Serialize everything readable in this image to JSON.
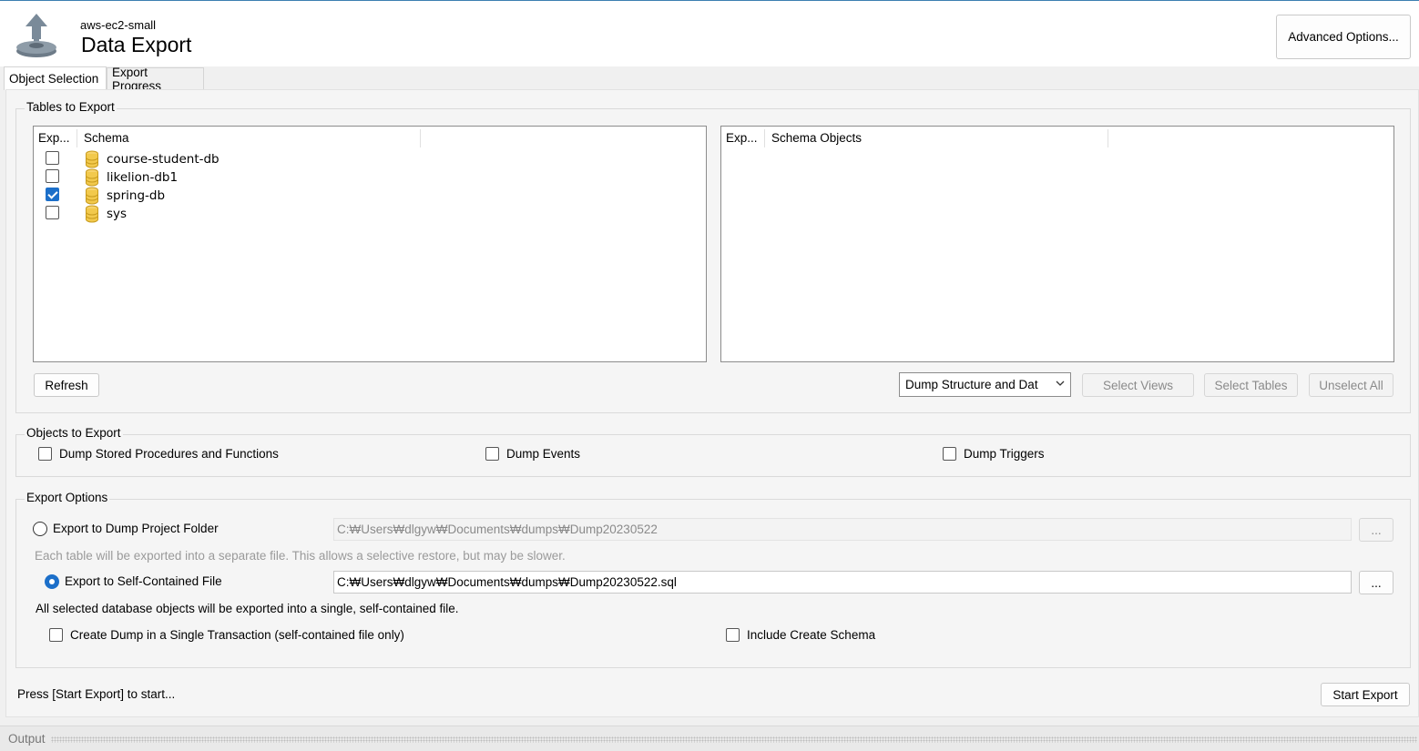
{
  "header": {
    "connection_name": "aws-ec2-small",
    "title": "Data Export",
    "advanced_options_label": "Advanced Options..."
  },
  "tabs": [
    {
      "label": "Object Selection",
      "active": true
    },
    {
      "label": "Export Progress",
      "active": false
    }
  ],
  "tables_to_export": {
    "group_title": "Tables to Export",
    "left_tree": {
      "columns": [
        "Exp...",
        "Schema"
      ],
      "rows": [
        {
          "schema": "course-student-db",
          "checked": false
        },
        {
          "schema": "likelion-db1",
          "checked": false
        },
        {
          "schema": "spring-db",
          "checked": true
        },
        {
          "schema": "sys",
          "checked": false
        }
      ]
    },
    "right_tree": {
      "columns": [
        "Exp...",
        "Schema Objects"
      ]
    },
    "refresh_label": "Refresh",
    "dump_mode_selected": "Dump Structure and Dat",
    "select_views_label": "Select Views",
    "select_tables_label": "Select Tables",
    "unselect_all_label": "Unselect All"
  },
  "objects_to_export": {
    "group_title": "Objects to Export",
    "stored_procedures_label": "Dump Stored Procedures and Functions",
    "events_label": "Dump Events",
    "triggers_label": "Dump Triggers"
  },
  "export_options": {
    "group_title": "Export Options",
    "project_folder_label": "Export to Dump Project Folder",
    "project_folder_path": "C:₩Users₩dlgyw₩Documents₩dumps₩Dump20230522",
    "project_folder_hint": "Each table will be exported into a separate file. This allows a selective restore, but may be slower.",
    "self_contained_label": "Export to Self-Contained File",
    "self_contained_path": "C:₩Users₩dlgyw₩Documents₩dumps₩Dump20230522.sql",
    "self_contained_hint": "All selected database objects will be exported into a single, self-contained file.",
    "browse_label": "...",
    "single_transaction_label": "Create Dump in a Single Transaction (self-contained file only)",
    "include_create_schema_label": "Include Create Schema"
  },
  "status": {
    "message": "Press [Start Export] to start...",
    "start_export_label": "Start Export"
  },
  "output_label": "Output",
  "colors": {
    "accent": "#1c6fc9",
    "db_icon": "#f2c94c"
  }
}
